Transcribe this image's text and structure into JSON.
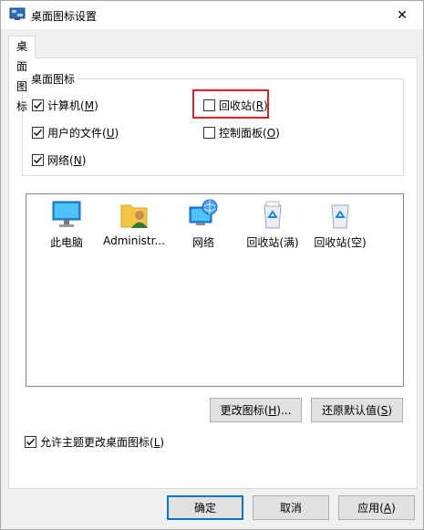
{
  "window": {
    "title": "桌面图标设置",
    "close_glyph": "✕"
  },
  "tabs": [
    {
      "label": "桌面图标"
    }
  ],
  "desktop_icons_group": {
    "title": "桌面图标",
    "checkboxes": [
      {
        "label": "计算机",
        "key": "M",
        "checked": true
      },
      {
        "label": "回收站",
        "key": "R",
        "checked": false,
        "highlighted": true
      },
      {
        "label": "用户的文件",
        "key": "U",
        "checked": true
      },
      {
        "label": "控制面板",
        "key": "O",
        "checked": false
      },
      {
        "label": "网络",
        "key": "N",
        "checked": true
      }
    ]
  },
  "icon_list": [
    {
      "label": "此电脑",
      "icon": "monitor-icon"
    },
    {
      "label": "Administr...",
      "icon": "user-folder-icon"
    },
    {
      "label": "网络",
      "icon": "network-globe-icon"
    },
    {
      "label": "回收站(满)",
      "icon": "recycle-bin-full-icon"
    },
    {
      "label": "回收站(空)",
      "icon": "recycle-bin-empty-icon"
    }
  ],
  "buttons": {
    "change_icon": {
      "label": "更改图标",
      "key": "H",
      "suffix": "..."
    },
    "restore_default": {
      "label": "还原默认值",
      "key": "S"
    },
    "ok": "确定",
    "cancel": "取消",
    "apply": {
      "label": "应用",
      "key": "A"
    }
  },
  "allow_themes": {
    "label": "允许主题更改桌面图标",
    "key": "L",
    "checked": true
  },
  "colors": {
    "highlight_box": "#e02020",
    "accent": "#0078d7"
  }
}
